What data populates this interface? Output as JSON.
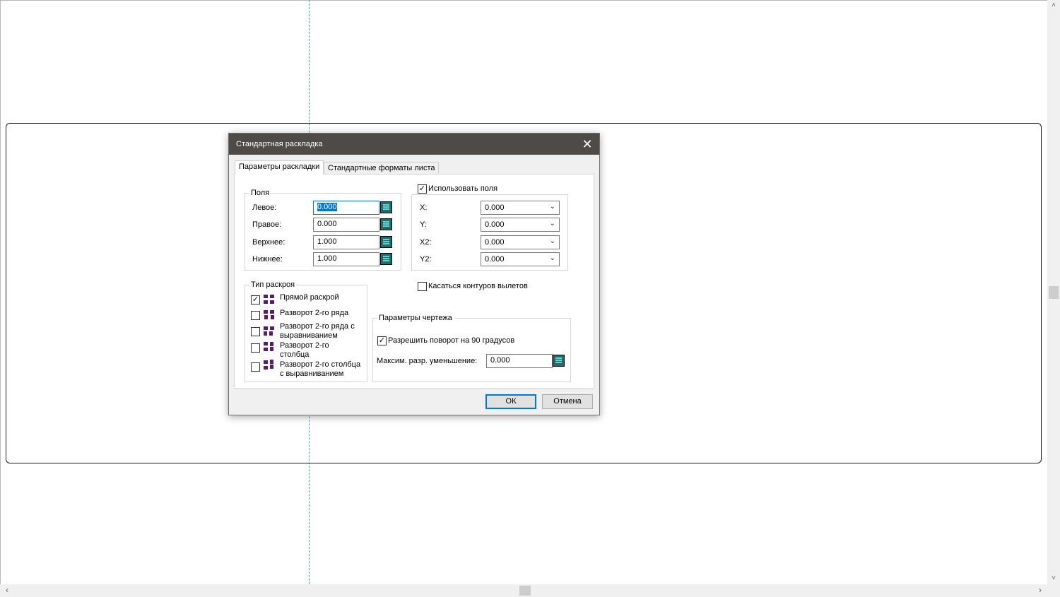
{
  "dialog": {
    "title": "Стандартная раскладка",
    "close_glyph": "✕",
    "tabs": [
      {
        "label": "Параметры раскладки",
        "active": true
      },
      {
        "label": "Стандартные форматы листа",
        "active": false
      }
    ],
    "margins": {
      "legend": "Поля",
      "fields": [
        {
          "label": "Левое:",
          "value": "0.000"
        },
        {
          "label": "Правое:",
          "value": "0.000"
        },
        {
          "label": "Верхнее:",
          "value": "1.000"
        },
        {
          "label": "Нижнее:",
          "value": "1.000"
        }
      ]
    },
    "use_fields": {
      "label": "Использовать поля",
      "checked": true,
      "coords": [
        {
          "label": "X:",
          "value": "0.000"
        },
        {
          "label": "Y:",
          "value": "0.000"
        },
        {
          "label": "X2:",
          "value": "0.000"
        },
        {
          "label": "Y2:",
          "value": "0.000"
        }
      ]
    },
    "touch_contours": {
      "label": "Касаться контуров вылетов",
      "checked": false
    },
    "cut_type": {
      "legend": "Тип раскроя",
      "options": [
        {
          "label_lines": [
            "Прямой раскрой"
          ],
          "checked": true,
          "icon": "direct-cut-icon"
        },
        {
          "label_lines": [
            "Разворот 2-го ряда"
          ],
          "checked": false,
          "icon": "row2-turn-icon"
        },
        {
          "label_lines": [
            "Разворот 2-го ряда с",
            "выравниванием"
          ],
          "checked": false,
          "icon": "row2-align-icon"
        },
        {
          "label_lines": [
            "Разворот 2-го",
            "столбца"
          ],
          "checked": false,
          "icon": "col2-turn-icon"
        },
        {
          "label_lines": [
            "Разворот 2-го столбца",
            "с выравниванием"
          ],
          "checked": false,
          "icon": "col2-align-icon"
        }
      ]
    },
    "drawing_params": {
      "legend": "Параметры чертежа",
      "allow_rotation": {
        "label": "Разрешить поворот на 90 градусов",
        "checked": true
      },
      "max_reduction": {
        "label": "Максим. разр. уменьшение:",
        "value": "0.000"
      }
    },
    "buttons": {
      "ok": "ОК",
      "cancel": "Отмена"
    }
  },
  "scrollbars": {
    "up_glyph": "˄",
    "down_glyph": "˅",
    "left_glyph": "‹",
    "right_glyph": "›"
  },
  "colors": {
    "titlebar": "#4d4a47",
    "accent": "#0078d7",
    "center_line": "#3b9be0",
    "icon_purple": "#5a1a6e"
  }
}
